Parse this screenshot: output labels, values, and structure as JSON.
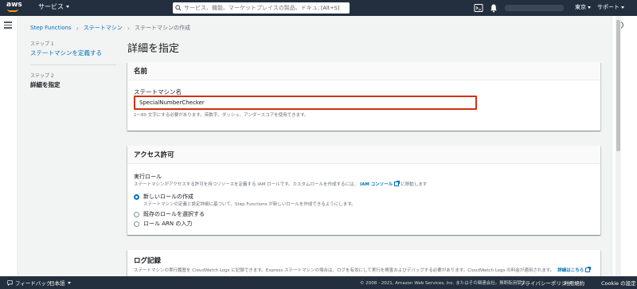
{
  "topnav": {
    "logo_text": "aws",
    "services_label": "サービス",
    "search_placeholder": "サービス、機能、マーケットプレイスの製品、ドキュメントを検索し",
    "search_shortcut": "[Alt+S]",
    "region_label": "東京",
    "support_label": "サポート"
  },
  "breadcrumb": {
    "items": [
      "Step Functions",
      "ステートマシン",
      "ステートマシンの作成"
    ]
  },
  "steps": {
    "step1_num": "ステップ 1",
    "step1_label": "ステートマシンを定義する",
    "step2_num": "ステップ 2",
    "step2_label": "詳細を指定"
  },
  "page_title": "詳細を指定",
  "name_panel": {
    "header": "名前",
    "field_label": "ステートマシン名",
    "field_value": "SpecialNumberChecker",
    "hint": "1〜80 文字にする必要があります。英数字、ダッシュ、アンダースコアを使用できます。"
  },
  "permissions_panel": {
    "header": "アクセス許可",
    "role_label": "実行ロール",
    "role_desc": "ステートマシンがアクセスする許可を持つリソースを定義する IAM ロールです。カスタムロールを作成するには、",
    "iam_link": "IAM コンソール",
    "role_desc_end": "に移動します",
    "options": [
      {
        "label": "新しいロールの作成",
        "checked": true,
        "desc": "ステートマシンの定義と設定詳細に基づいて、Step Functions が新しいロールを作成できるようにします。"
      },
      {
        "label": "既存のロールを選択する",
        "checked": false
      },
      {
        "label": "ロール ARN の入力",
        "checked": false
      }
    ]
  },
  "log_panel": {
    "header": "ログ記録",
    "desc": "ステートマシンの実行履歴を CloudWatch Logs に記録できます。Express ステートマシンの場合は、ログを有効にして実行を検査およびデバッグする必要があります。CloudWatch Logs の料金が適用されます。",
    "more_link": "詳細はこちら"
  },
  "footer": {
    "feedback": "フィードバック",
    "language": "日本語",
    "copyright": "© 2008 - 2021, Amazon Web Services, Inc. またはその関連会社。無断転用禁止。",
    "privacy": "プライバシーポリシー",
    "terms": "利用規約",
    "cookie": "Cookie の設定"
  },
  "colors": {
    "nav_bg": "#232f3e",
    "link": "#0073bb",
    "error_border": "#d13212",
    "logo_accent": "#ff9900"
  }
}
